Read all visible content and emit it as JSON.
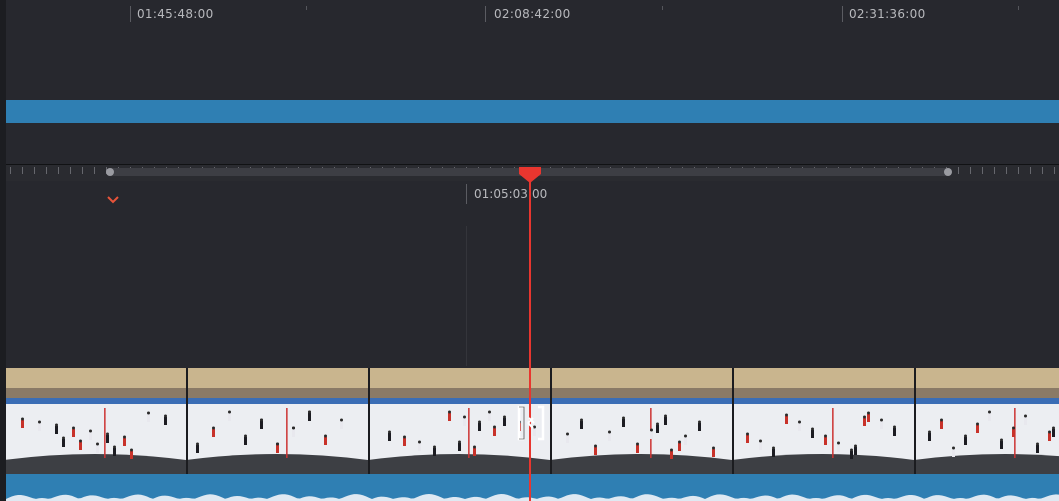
{
  "upper_ruler": {
    "timecodes": [
      "01:45:48:00",
      "02:08:42:00",
      "02:31:36:00"
    ]
  },
  "upper_timeline": {
    "clip_color": "#2f7fb3"
  },
  "zoom_timeline": {
    "playhead_timecode": "01:05:03:00",
    "playhead_color": "#e8362f",
    "marker_color": "#e8543a"
  },
  "video_track": {
    "thumbnail_count": 6,
    "thumbnail_subject": "ice hockey game"
  },
  "audio_track": {
    "color": "#2f7fb3"
  },
  "icons": [
    "playhead-icon",
    "marker-chevron-icon",
    "trim-cursor-icon",
    "range-handle-icon"
  ]
}
